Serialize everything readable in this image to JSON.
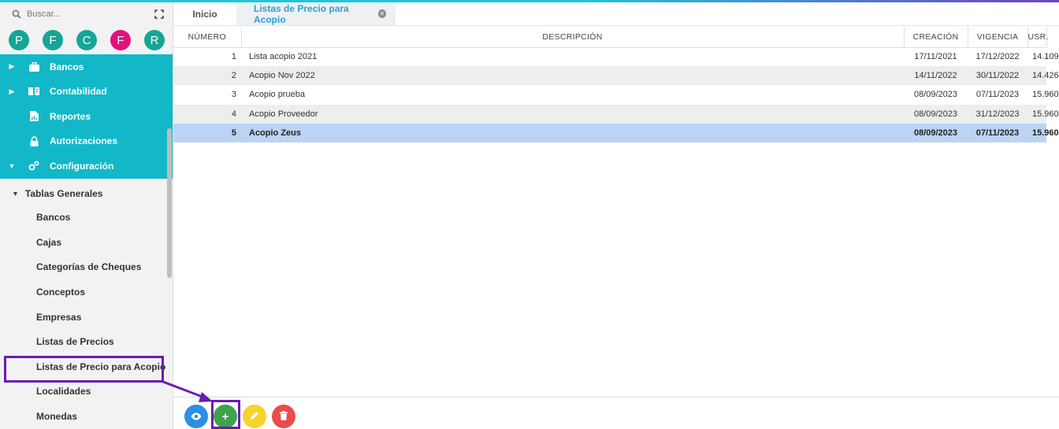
{
  "search": {
    "placeholder": "Buscar..."
  },
  "avatars": [
    {
      "letter": "P",
      "color": "#16a596"
    },
    {
      "letter": "F",
      "color": "#16a596"
    },
    {
      "letter": "C",
      "color": "#16a596"
    },
    {
      "letter": "F",
      "color": "#e0137a"
    },
    {
      "letter": "R",
      "color": "#16a596"
    }
  ],
  "menu": {
    "items": [
      {
        "label": "Bancos",
        "icon": "briefcase-icon"
      },
      {
        "label": "Contabilidad",
        "icon": "book-icon"
      },
      {
        "label": "Reportes",
        "icon": "report-icon"
      },
      {
        "label": "Autorizaciones",
        "icon": "lock-icon"
      },
      {
        "label": "Configuración",
        "icon": "gears-icon"
      }
    ]
  },
  "submenu": {
    "title": "Tablas Generales",
    "items": [
      "Bancos",
      "Cajas",
      "Categorías de Cheques",
      "Conceptos",
      "Empresas",
      "Listas de Precios",
      "Listas de Precio para Acopio",
      "Localidades",
      "Monedas"
    ]
  },
  "tabs": {
    "home": "Inicio",
    "active": "Listas de Precio para Acopio"
  },
  "table": {
    "columns": [
      "NÚMERO",
      "DESCRIPCIÓN",
      "CREACIÓN",
      "VIGENCIA",
      "USR."
    ],
    "rows": [
      {
        "numero": "1",
        "descripcion": "Lista acopio 2021",
        "creacion": "17/11/2021",
        "vigencia": "17/12/2022",
        "usr": "14.109"
      },
      {
        "numero": "2",
        "descripcion": "Acopio Nov 2022",
        "creacion": "14/11/2022",
        "vigencia": "30/11/2022",
        "usr": "14.426"
      },
      {
        "numero": "3",
        "descripcion": "Acopio prueba",
        "creacion": "08/09/2023",
        "vigencia": "07/11/2023",
        "usr": "15.960"
      },
      {
        "numero": "4",
        "descripcion": "Acopio Proveedor",
        "creacion": "08/09/2023",
        "vigencia": "31/12/2023",
        "usr": "15.960"
      },
      {
        "numero": "5",
        "descripcion": "Acopio Zeus",
        "creacion": "08/09/2023",
        "vigencia": "07/11/2023",
        "usr": "15.960"
      }
    ]
  },
  "toolbar": {
    "add_label": "+",
    "colors": {
      "view": "#2b8fe3",
      "add": "#3ea34a",
      "edit": "#f6d32d",
      "delete": "#ea4c4c"
    }
  },
  "colors": {
    "accent": "#12b8c8",
    "selected_row": "#bcd4f3",
    "annotation": "#6a1bb3"
  }
}
